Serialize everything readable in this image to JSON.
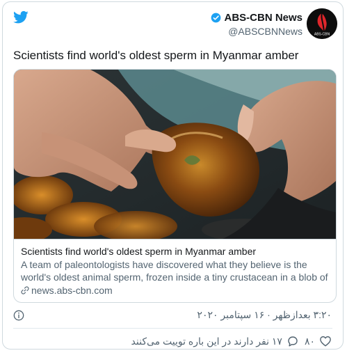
{
  "author": {
    "display_name": "ABS-CBN News",
    "handle": "@ABSCBNNews",
    "avatar_text": "ABS-CBN"
  },
  "tweet": {
    "text": "Scientists find world's oldest sperm in Myanmar amber"
  },
  "card": {
    "title": "Scientists find world's oldest sperm in Myanmar amber",
    "description": "A team of paleontologists have discovered what they believe is the world's oldest animal sperm, frozen inside a tiny crustacean in a blob of tree resi...",
    "domain": "news.abs-cbn.com"
  },
  "timestamp": "۳:۲۰ بعدازظهر · ۱۶ سپتامبر ۲۰۲۰",
  "actions": {
    "like_count": "۸۰",
    "reply_text": "۱۷ نفر دارند در این باره توییت می‌کنند"
  },
  "colors": {
    "twitter_blue": "#1da1f2",
    "text_primary": "#14171a",
    "text_secondary": "#536471",
    "border": "#cfd9de",
    "brand_red": "#e0262b"
  },
  "icons": {
    "logo": "twitter-bird-icon",
    "verified": "verified-badge-icon",
    "info": "info-icon",
    "link": "link-icon",
    "like": "heart-icon",
    "reply": "speech-bubble-icon"
  }
}
